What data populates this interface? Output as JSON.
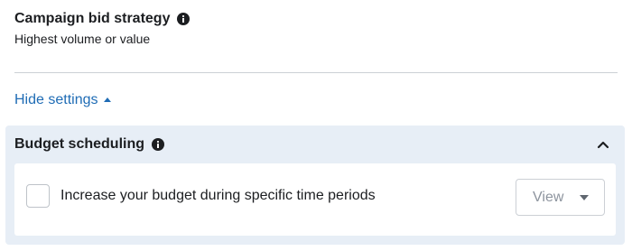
{
  "strategy": {
    "title": "Campaign bid strategy",
    "info_icon": "info-icon",
    "value": "Highest volume or value"
  },
  "toggle": {
    "label": "Hide settings",
    "icon": "caret-up-icon"
  },
  "budget_scheduling": {
    "title": "Budget scheduling",
    "info_icon": "info-icon",
    "collapse_icon": "chevron-up-icon",
    "checkbox_label": "Increase your budget during specific time periods",
    "checkbox_checked": false,
    "view_button_label": "View",
    "view_icon": "caret-down-icon"
  },
  "colors": {
    "link": "#1f6cb5",
    "panel_background": "#e7eef6",
    "text": "#1c1e21"
  }
}
